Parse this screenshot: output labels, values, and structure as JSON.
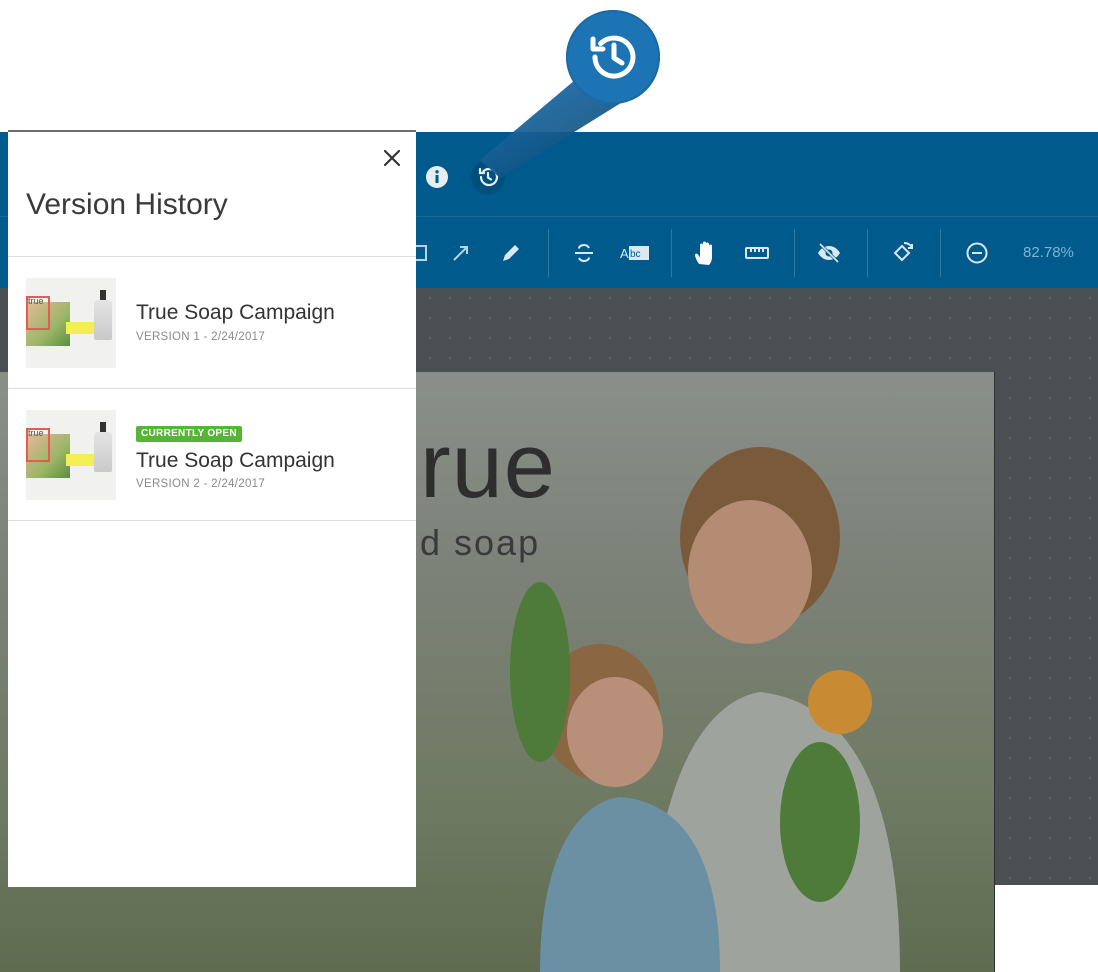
{
  "panel": {
    "title": "Version History",
    "close_icon": "close-icon",
    "versions": [
      {
        "title": "True Soap Campaign",
        "meta": "VERSION 1 - 2/24/2017",
        "badge": ""
      },
      {
        "title": "True Soap Campaign",
        "meta": "VERSION 2 - 2/24/2017",
        "badge": "CURRENTLY OPEN"
      }
    ]
  },
  "topbar": {
    "icons": [
      "info-icon",
      "history-icon"
    ]
  },
  "toolbar": {
    "icons": [
      "rectangle-icon",
      "arrow-icon",
      "pencil-icon",
      "strikethrough-icon",
      "text-replace-icon",
      "hand-icon",
      "ruler-icon",
      "hide-icon",
      "rotate-icon",
      "zoom-out-icon"
    ],
    "zoom": "82.78%"
  },
  "artboard": {
    "title": "rue",
    "subtitle": "d soap"
  },
  "callout": {
    "icon": "history-icon"
  },
  "colors": {
    "brand_blue": "#005b8c",
    "callout_blue": "#1c74b4",
    "badge_green": "#56b436"
  }
}
